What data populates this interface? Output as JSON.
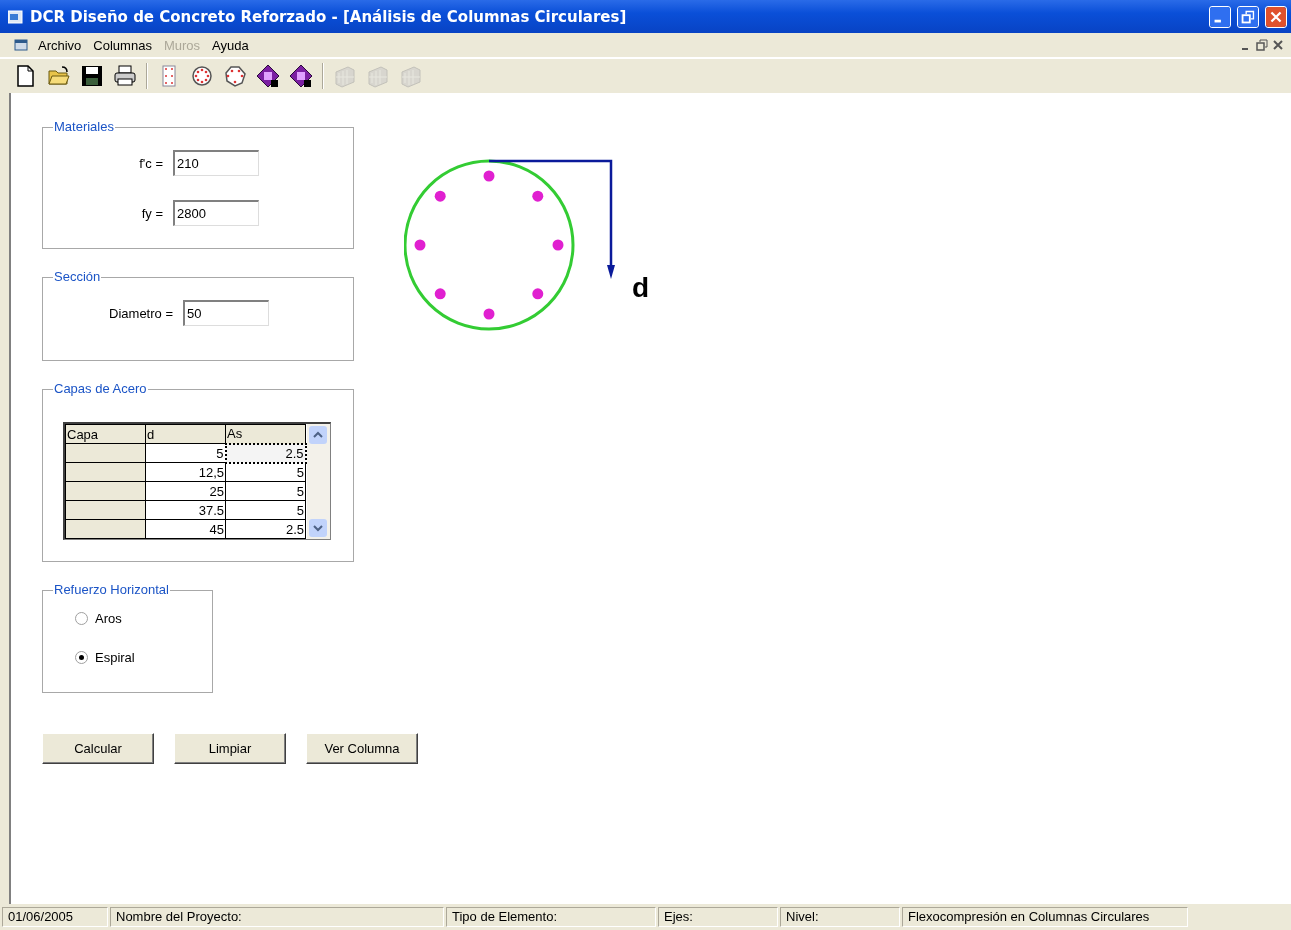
{
  "window": {
    "title": "DCR Diseño de Concreto Reforzado - [Análisis de Columnas Circulares]"
  },
  "menu": [
    {
      "label": "Archivo",
      "disabled": false
    },
    {
      "label": "Columnas",
      "disabled": false
    },
    {
      "label": "Muros",
      "disabled": true
    },
    {
      "label": "Ayuda",
      "disabled": false
    }
  ],
  "toolbar": [
    {
      "kind": "new",
      "disabled": false
    },
    {
      "kind": "open",
      "disabled": false
    },
    {
      "kind": "save",
      "disabled": false
    },
    {
      "kind": "print",
      "disabled": false
    },
    {
      "kind": "separator"
    },
    {
      "kind": "rect-column",
      "disabled": false
    },
    {
      "kind": "circle-column",
      "disabled": false
    },
    {
      "kind": "polygon-column",
      "disabled": false
    },
    {
      "kind": "wall-a",
      "disabled": false
    },
    {
      "kind": "wall-d",
      "disabled": false
    },
    {
      "kind": "separator"
    },
    {
      "kind": "grid",
      "disabled": true
    },
    {
      "kind": "grid",
      "disabled": true
    },
    {
      "kind": "grid",
      "disabled": true
    }
  ],
  "materiales": {
    "title": "Materiales",
    "fields": [
      {
        "label": "f'c =",
        "value": "210"
      },
      {
        "label": "fy =",
        "value": "2800"
      }
    ]
  },
  "seccion": {
    "title": "Sección",
    "fields": [
      {
        "label": "Diametro =",
        "value": "50"
      }
    ]
  },
  "capas": {
    "title": "Capas de Acero",
    "columns": [
      "Capa",
      "d",
      "As"
    ],
    "rows": [
      {
        "d": "5",
        "as": "2.5",
        "focused": true
      },
      {
        "d": "12,5",
        "as": "5",
        "focused": false
      },
      {
        "d": "25",
        "as": "5",
        "focused": false
      },
      {
        "d": "37.5",
        "as": "5",
        "focused": false
      },
      {
        "d": "45",
        "as": "2.5",
        "focused": false
      }
    ]
  },
  "refuerzo": {
    "title": "Refuerzo Horizontal",
    "options": [
      {
        "label": "Aros",
        "selected": false
      },
      {
        "label": "Espiral",
        "selected": true
      }
    ]
  },
  "buttons": [
    {
      "label": "Calcular"
    },
    {
      "label": "Limpiar"
    },
    {
      "label": "Ver Columna"
    }
  ],
  "diagram": {
    "label": "d"
  },
  "status_bar": [
    "01/06/2005",
    "Nombre del Proyecto:",
    "Tipo de Elemento:",
    "Ejes:",
    "Nivel:",
    "Flexocompresión en Columnas Circulares"
  ]
}
